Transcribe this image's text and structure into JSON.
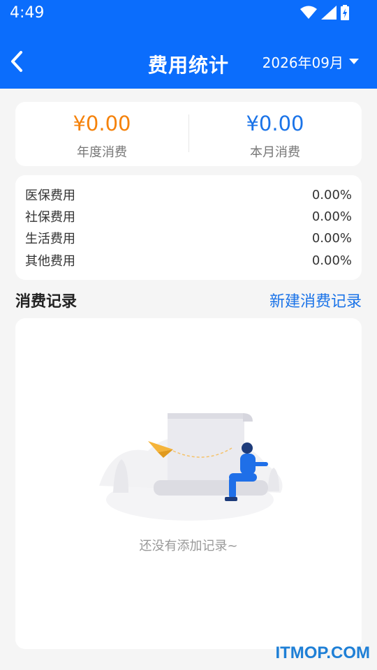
{
  "status_bar": {
    "time": "4:49"
  },
  "header": {
    "title": "费用统计",
    "month": "2026年09月"
  },
  "summary": {
    "annual_value": "¥0.00",
    "annual_label": "年度消费",
    "monthly_value": "¥0.00",
    "monthly_label": "本月消费"
  },
  "breakdown": [
    {
      "label": "医保费用",
      "percent": "0.00%"
    },
    {
      "label": "社保费用",
      "percent": "0.00%"
    },
    {
      "label": "生活费用",
      "percent": "0.00%"
    },
    {
      "label": "其他费用",
      "percent": "0.00%"
    }
  ],
  "records": {
    "section_title": "消费记录",
    "new_link": "新建消费记录",
    "empty_text": "还没有添加记录~"
  },
  "watermark": "ITMOP.COM",
  "colors": {
    "header": "#0b6dfc",
    "annual_value": "#f5820b",
    "monthly_value": "#1a73e8",
    "link": "#1a73e8"
  }
}
